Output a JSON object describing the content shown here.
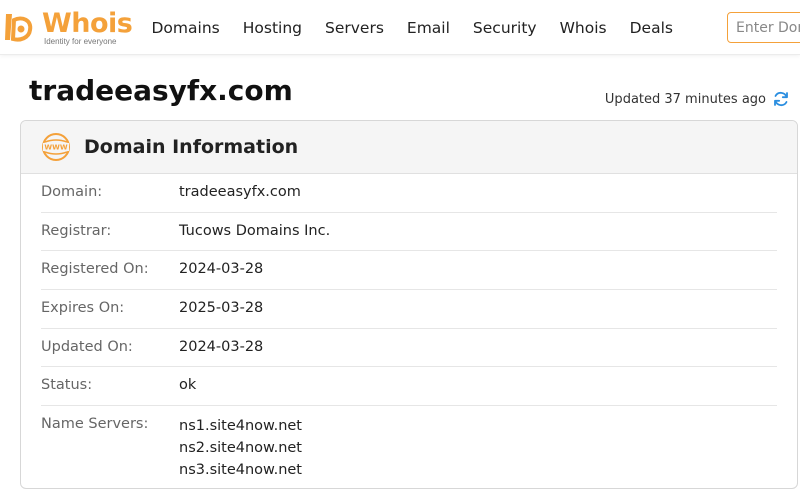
{
  "colors": {
    "brand": "#f4a13a",
    "refresh": "#2a8ee0"
  },
  "logo": {
    "word": "Whois",
    "tagline": "Identity for everyone"
  },
  "nav": {
    "items": [
      "Domains",
      "Hosting",
      "Servers",
      "Email",
      "Security",
      "Whois",
      "Deals"
    ]
  },
  "search": {
    "placeholder": "Enter Domain"
  },
  "page": {
    "domain": "tradeeasyfx.com",
    "updated": "Updated 37 minutes ago"
  },
  "card": {
    "title": "Domain Information",
    "rows": [
      {
        "label": "Domain:",
        "value": "tradeeasyfx.com"
      },
      {
        "label": "Registrar:",
        "value": "Tucows Domains Inc."
      },
      {
        "label": "Registered On:",
        "value": "2024-03-28"
      },
      {
        "label": "Expires On:",
        "value": "2025-03-28"
      },
      {
        "label": "Updated On:",
        "value": "2024-03-28"
      },
      {
        "label": "Status:",
        "value": "ok"
      }
    ],
    "name_servers": {
      "label": "Name Servers:",
      "values": [
        "ns1.site4now.net",
        "ns2.site4now.net",
        "ns3.site4now.net"
      ]
    }
  },
  "icons": {
    "logo": "whois-logo-icon",
    "www": "www-globe-icon",
    "refresh": "refresh-icon"
  }
}
